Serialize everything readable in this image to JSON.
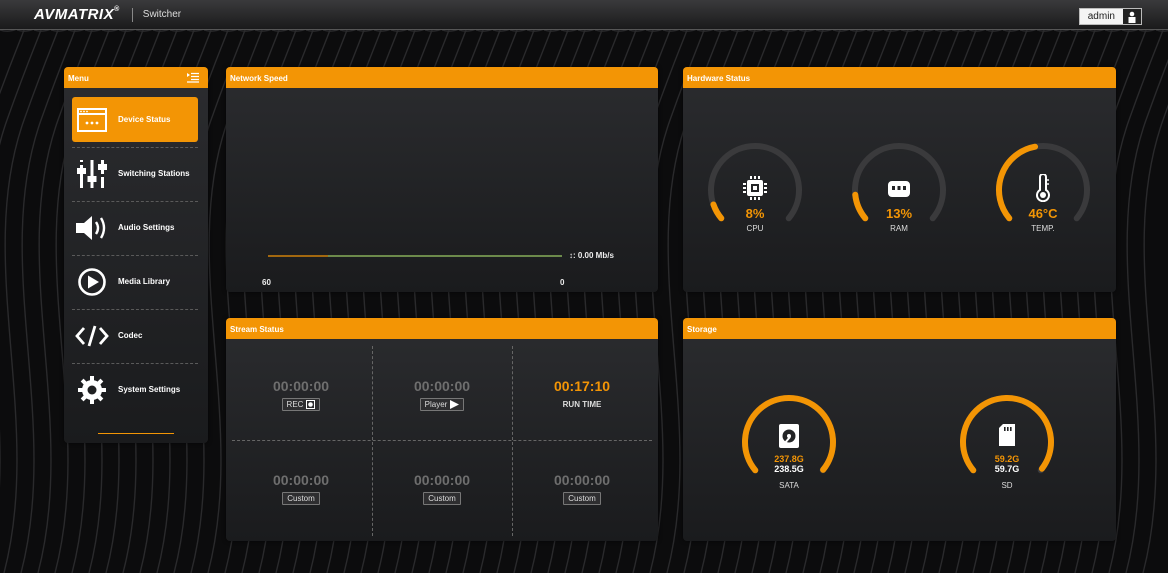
{
  "header": {
    "brand": "AVMATRIX",
    "brand_mark": "®",
    "app_title": "Switcher",
    "user": "admin"
  },
  "menu": {
    "title": "Menu",
    "items": [
      {
        "label": "Device Status",
        "icon": "window-icon",
        "active": true
      },
      {
        "label": "Switching Stations",
        "icon": "sliders-icon",
        "active": false
      },
      {
        "label": "Audio Settings",
        "icon": "speaker-icon",
        "active": false
      },
      {
        "label": "Media Library",
        "icon": "play-circle-icon",
        "active": false
      },
      {
        "label": "Codec",
        "icon": "code-icon",
        "active": false
      },
      {
        "label": "System Settings",
        "icon": "gear-icon",
        "active": false
      }
    ]
  },
  "network": {
    "title": "Network Speed",
    "speed_label": "↕: 0.00 Mb/s",
    "axis_start": "60",
    "axis_end": "0"
  },
  "hardware": {
    "title": "Hardware Status",
    "gauges": [
      {
        "label": "CPU",
        "value": "8%",
        "fraction": 0.08,
        "icon": "chip-icon"
      },
      {
        "label": "RAM",
        "value": "13%",
        "fraction": 0.13,
        "icon": "memory-icon"
      },
      {
        "label": "TEMP.",
        "value": "46°C",
        "fraction": 0.46,
        "icon": "thermometer-icon"
      }
    ]
  },
  "stream": {
    "title": "Stream Status",
    "cells": [
      {
        "time": "00:00:00",
        "tag": "REC",
        "tag_icon": "record-icon",
        "highlight": false
      },
      {
        "time": "00:00:00",
        "tag": "Player",
        "tag_icon": "play-icon",
        "highlight": false
      },
      {
        "time": "00:17:10",
        "tag": "RUN TIME",
        "tag_icon": "",
        "highlight": true
      },
      {
        "time": "00:00:00",
        "tag": "Custom",
        "tag_icon": "",
        "highlight": false
      },
      {
        "time": "00:00:00",
        "tag": "Custom",
        "tag_icon": "",
        "highlight": false
      },
      {
        "time": "00:00:00",
        "tag": "Custom",
        "tag_icon": "",
        "highlight": false
      }
    ]
  },
  "storage": {
    "title": "Storage",
    "drives": [
      {
        "label": "SATA",
        "used": "237.8G",
        "total": "238.5G",
        "fraction": 0.997,
        "icon": "hard-drive-icon"
      },
      {
        "label": "SD",
        "used": "59.2G",
        "total": "59.7G",
        "fraction": 0.99,
        "icon": "sd-card-icon"
      }
    ]
  },
  "colors": {
    "accent": "#f39505",
    "track": "#3a3a3c",
    "line_green": "#9ccc65"
  }
}
